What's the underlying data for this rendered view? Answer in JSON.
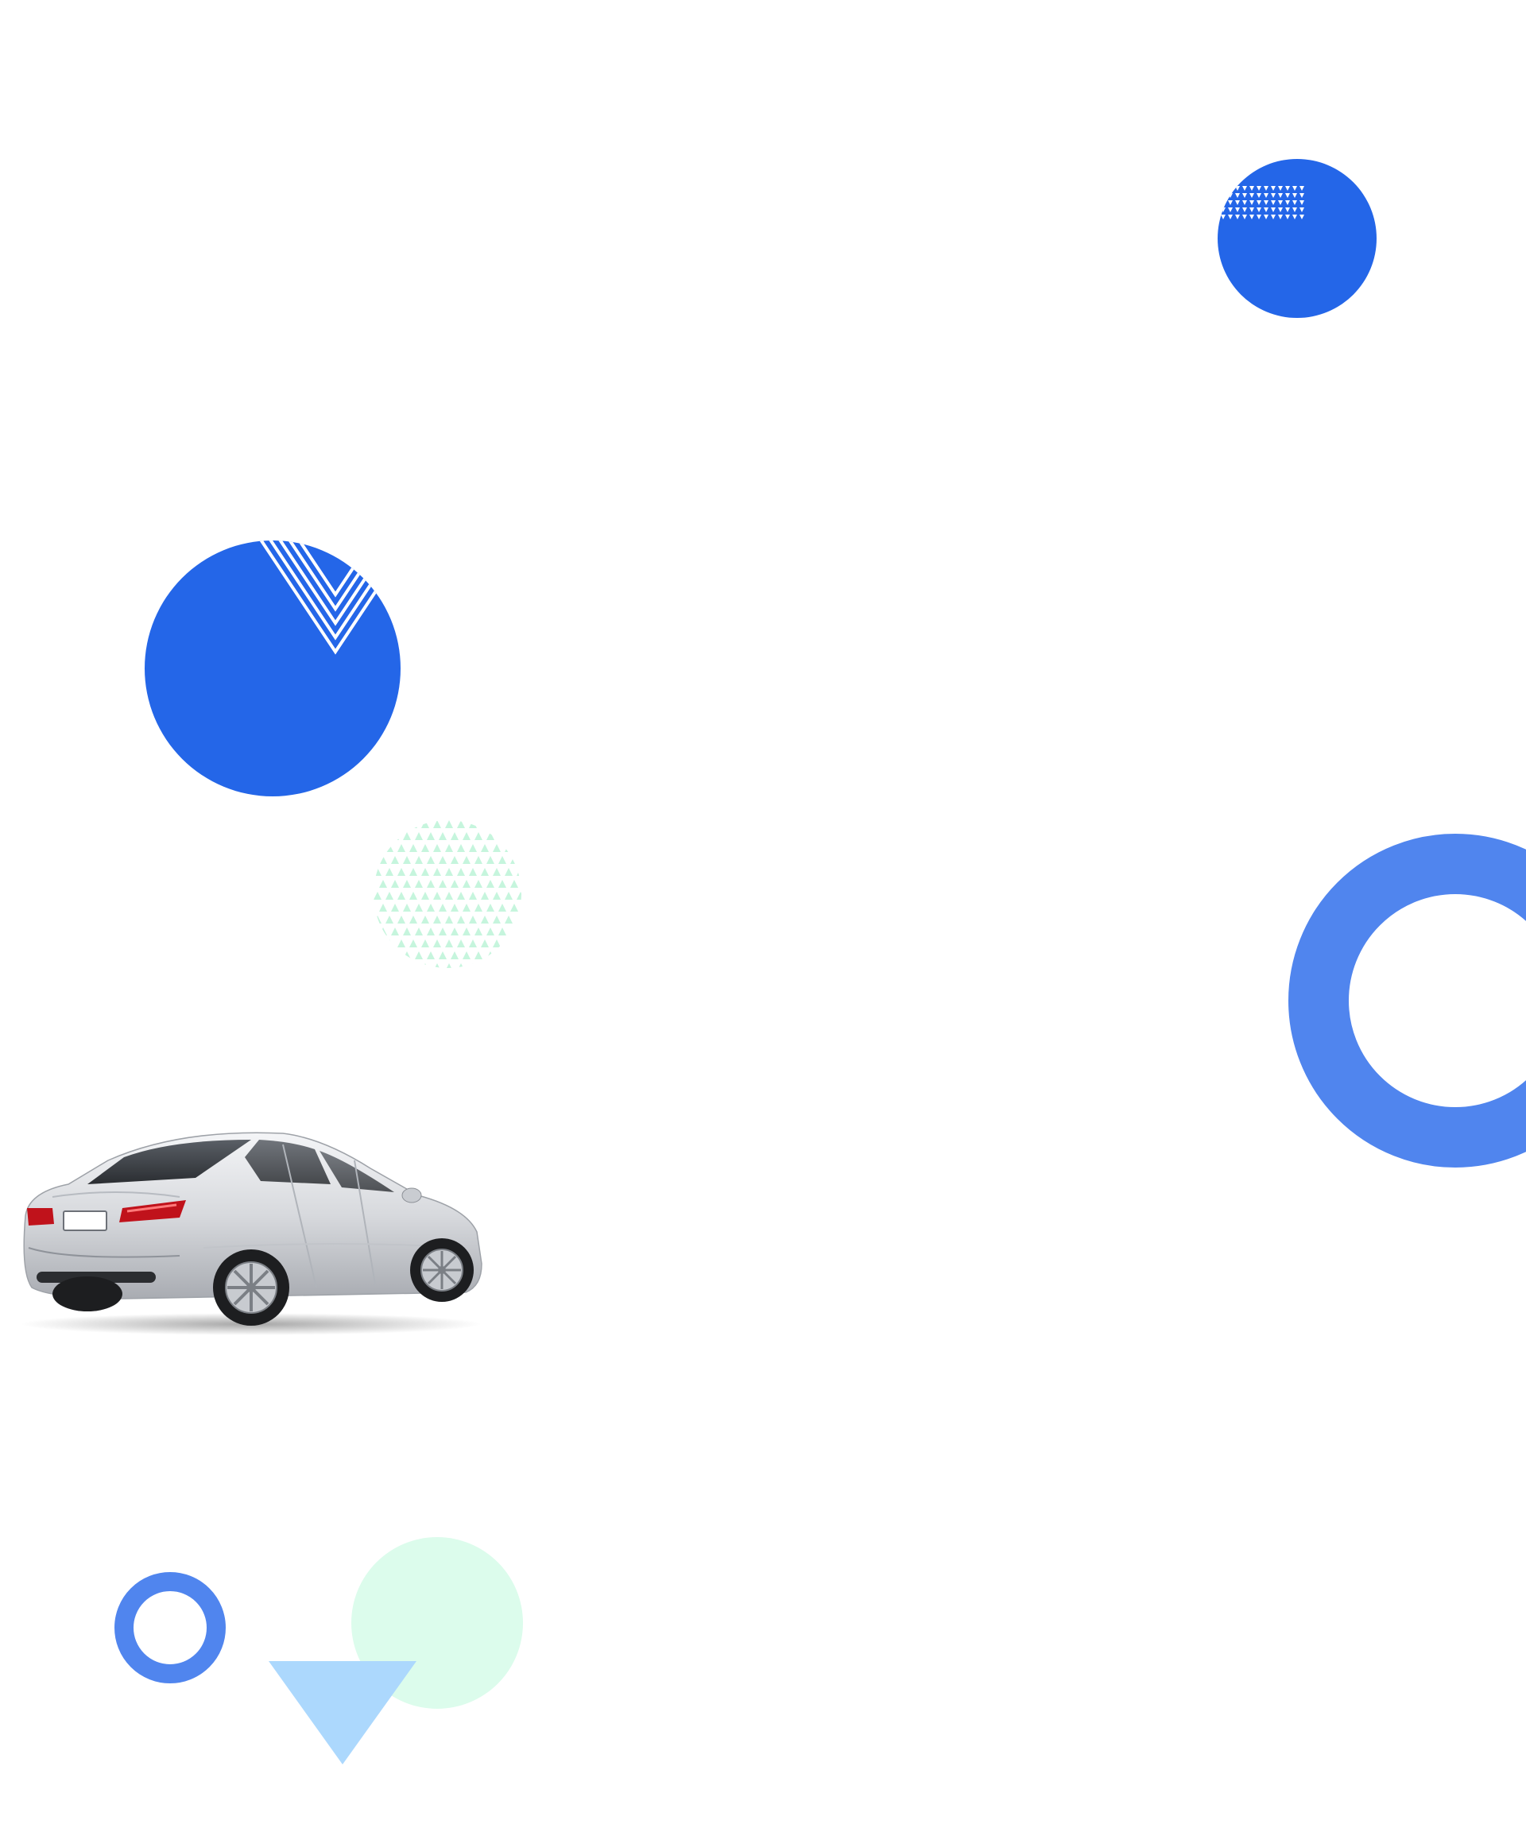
{
  "page": {
    "background": "#ffffff"
  },
  "colors": {
    "primary_blue": "#2466e8",
    "ring_blue": "#5085ee",
    "mint": "#dcfcec",
    "mint_pattern": "#c6f5dd",
    "light_blue": "#acd8fd",
    "white": "#ffffff"
  },
  "decorations": [
    "blue-circle-with-triangle-dots",
    "blue-circle-with-chevron-stripes",
    "mint-triangle-pattern-circle",
    "large-blue-ring",
    "small-blue-ring",
    "mint-circle",
    "light-blue-triangle"
  ],
  "illustration": {
    "subject": "silver-sedan-car"
  }
}
